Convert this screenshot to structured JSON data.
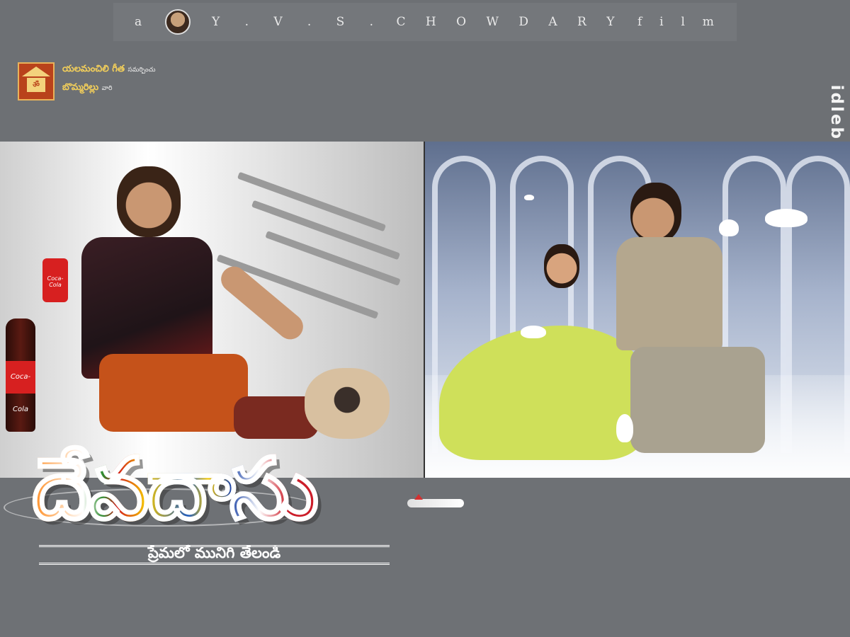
{
  "credit": {
    "prefix": "a",
    "letters1": [
      "Y",
      ".",
      "V",
      ".",
      "S",
      "."
    ],
    "letters2": [
      "C",
      "H",
      "O",
      "W",
      "D",
      "A",
      "R",
      "Y"
    ],
    "suffix": [
      "f",
      "i",
      "l",
      "m"
    ]
  },
  "production": {
    "logo_text": "ॐ",
    "line1": "యలమంచిలి గీత",
    "line1_small": "సమర్పించు",
    "line2": "బొమ్మరిల్లు",
    "line2_small": "వారి"
  },
  "watermark": "idlebrain.com",
  "bottle_label": "Coca-Cola",
  "can_label": "Coca-Cola",
  "title": "దేవదాసు",
  "tagline": "ప్రేమలో మునిగి తేలండి"
}
